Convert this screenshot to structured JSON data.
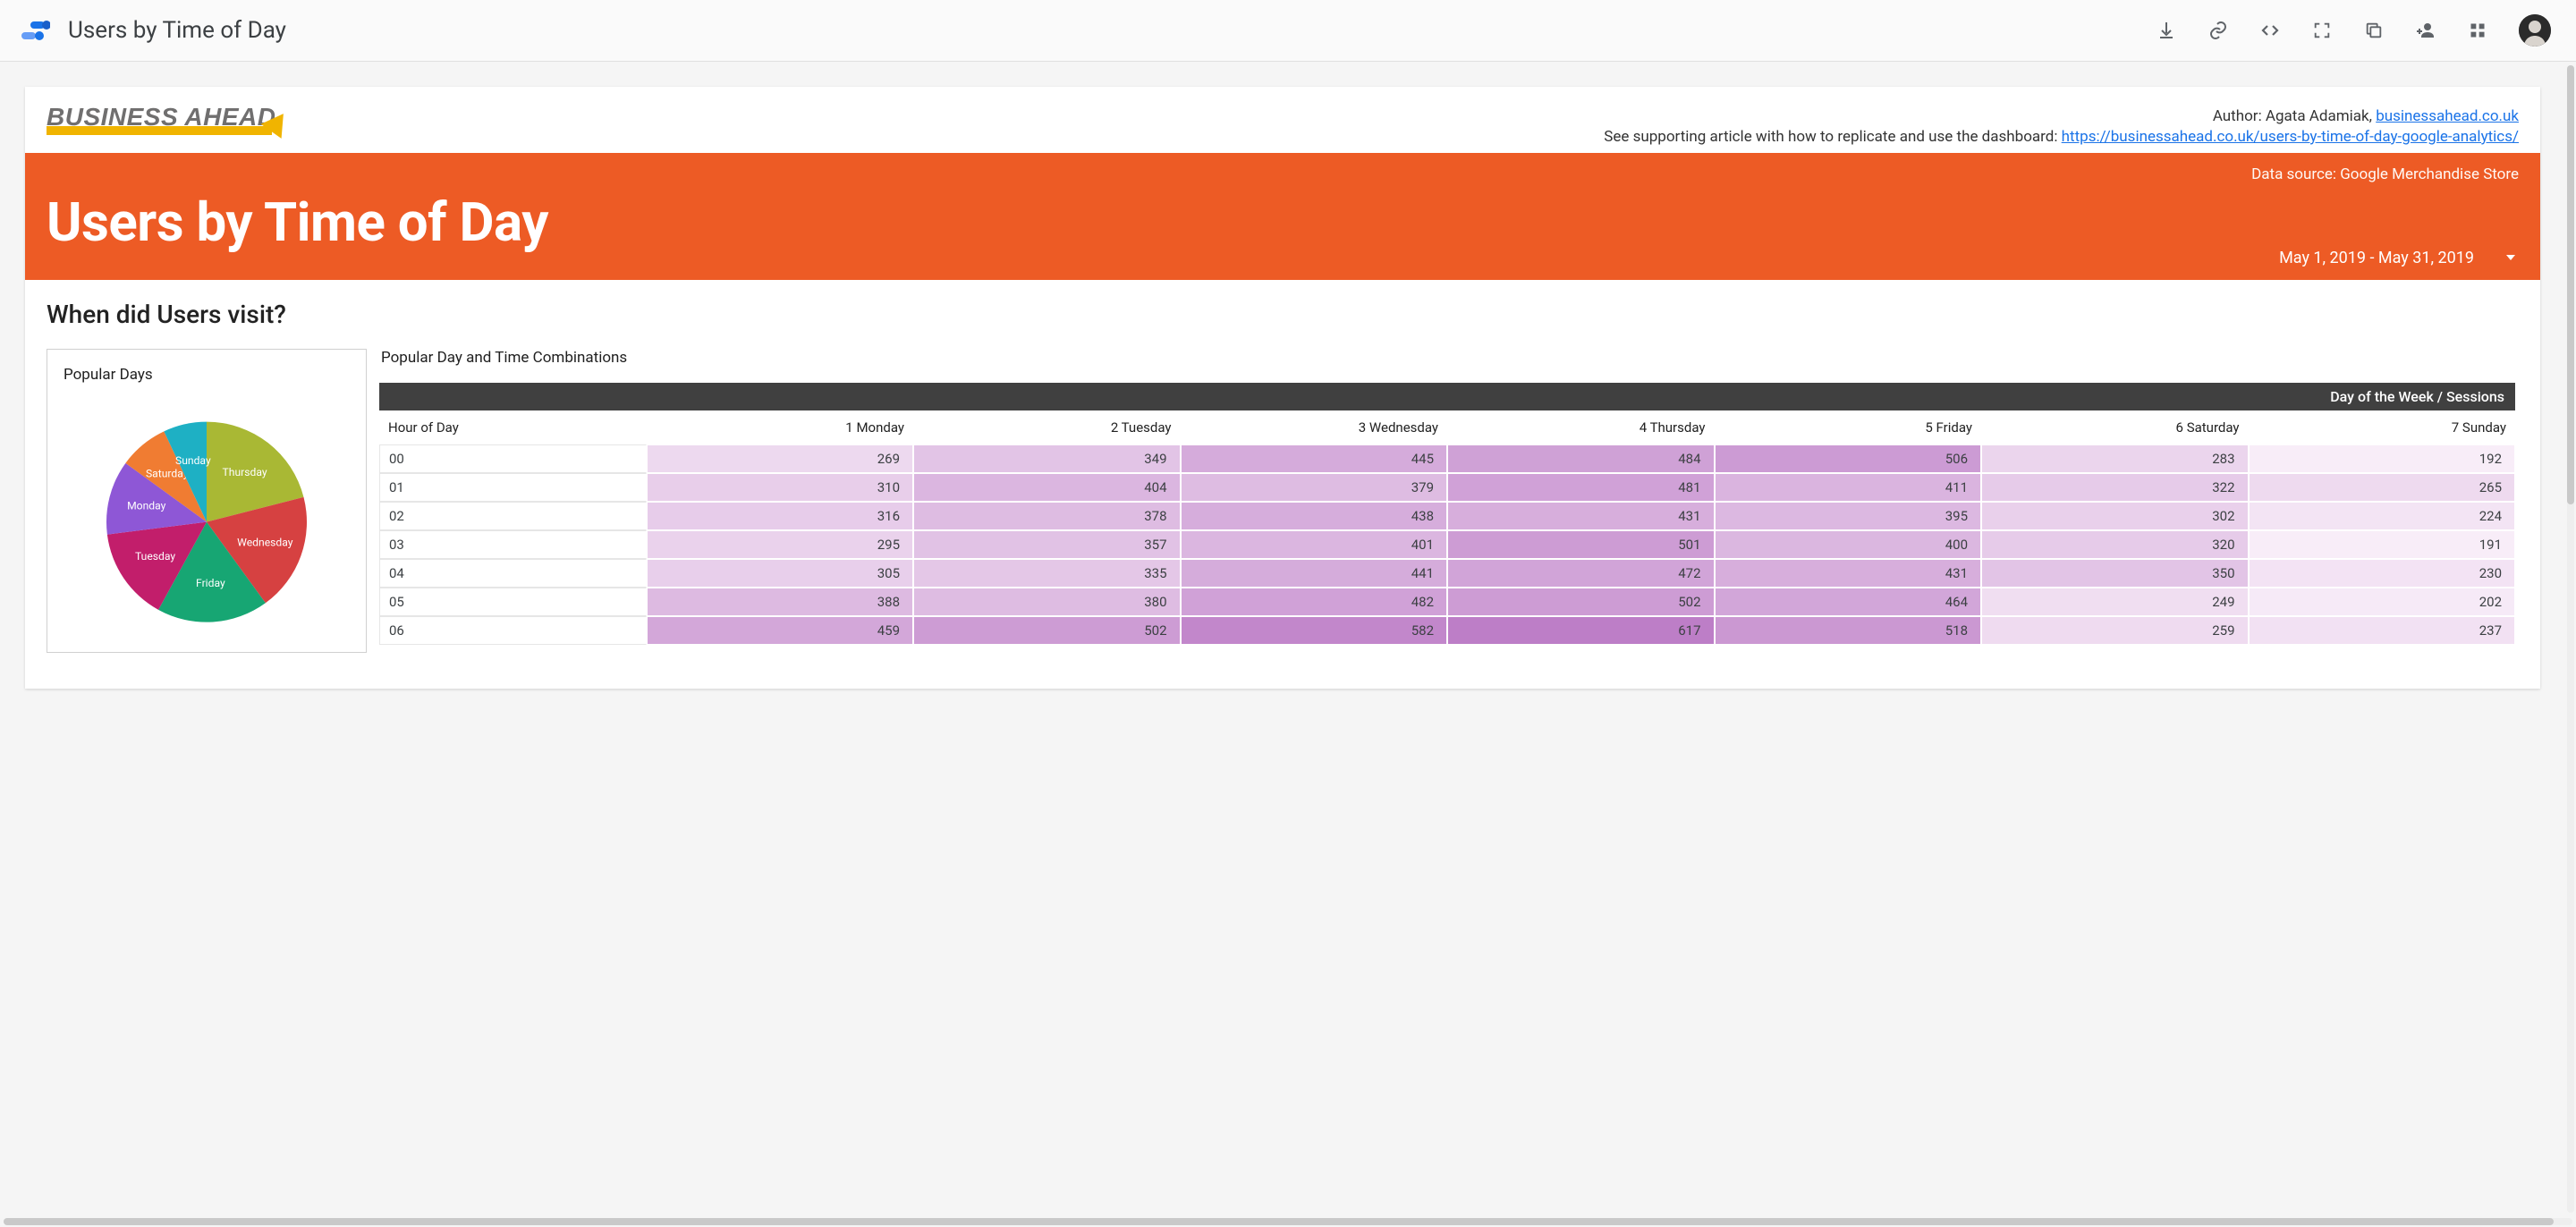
{
  "app": {
    "title": "Users by Time of Day"
  },
  "toolbar_icons": {
    "download": "download-icon",
    "link": "link-icon",
    "embed": "embed-code-icon",
    "fullscreen": "fullscreen-icon",
    "copy": "copy-icon",
    "add_person": "add-person-icon",
    "apps": "apps-grid-icon"
  },
  "brand_text": "BUSINESS AHEAD",
  "header_meta": {
    "author_label": "Author: Agata Adamiak, ",
    "author_link_text": "businessahead.co.uk",
    "supporting_text": "See supporting article with how to replicate and use the dashboard: ",
    "supporting_link_text": "https://businessahead.co.uk/users-by-time-of-day-google-analytics/ "
  },
  "hero": {
    "title": "Users by Time of Day",
    "data_source": "Data source: Google Merchandise Store",
    "date_range": "May 1, 2019 - May 31, 2019"
  },
  "section_title": "When did Users visit?",
  "pie_title": "Popular Days",
  "heatmap": {
    "title": "Popular Day and Time Combinations",
    "strip_label": "Day of the Week / Sessions",
    "row_label": "Hour of Day",
    "columns": [
      "1 Monday",
      "2 Tuesday",
      "3 Wednesday",
      "4 Thursday",
      "5 Friday",
      "6 Saturday",
      "7 Sunday"
    ]
  },
  "chart_data": [
    {
      "type": "pie",
      "title": "Popular Days",
      "series": [
        {
          "name": "Thursday",
          "value": 21,
          "color": "#a9b834"
        },
        {
          "name": "Wednesday",
          "value": 19,
          "color": "#d64141"
        },
        {
          "name": "Friday",
          "value": 18,
          "color": "#17a673"
        },
        {
          "name": "Tuesday",
          "value": 15,
          "color": "#c21e6b"
        },
        {
          "name": "Monday",
          "value": 12,
          "color": "#8e57d6"
        },
        {
          "name": "Saturday",
          "value": 8,
          "color": "#f07c32"
        },
        {
          "name": "Sunday",
          "value": 7,
          "color": "#1eb0c4"
        }
      ]
    },
    {
      "type": "heatmap",
      "title": "Popular Day and Time Combinations",
      "xlabel": "Day of the Week / Sessions",
      "ylabel": "Hour of Day",
      "x": [
        "1 Monday",
        "2 Tuesday",
        "3 Wednesday",
        "4 Thursday",
        "5 Friday",
        "6 Saturday",
        "7 Sunday"
      ],
      "y": [
        "00",
        "01",
        "02",
        "03",
        "04",
        "05",
        "06"
      ],
      "values": [
        [
          269,
          349,
          445,
          484,
          506,
          283,
          192
        ],
        [
          310,
          404,
          379,
          481,
          411,
          322,
          265
        ],
        [
          316,
          378,
          438,
          431,
          395,
          302,
          224
        ],
        [
          295,
          357,
          401,
          501,
          400,
          320,
          191
        ],
        [
          305,
          335,
          441,
          472,
          431,
          350,
          230
        ],
        [
          388,
          380,
          482,
          502,
          464,
          249,
          202
        ],
        [
          459,
          502,
          582,
          617,
          518,
          259,
          237
        ]
      ],
      "color_scale": {
        "low": "#f8edf8",
        "high": "#bd7ec7"
      }
    }
  ]
}
